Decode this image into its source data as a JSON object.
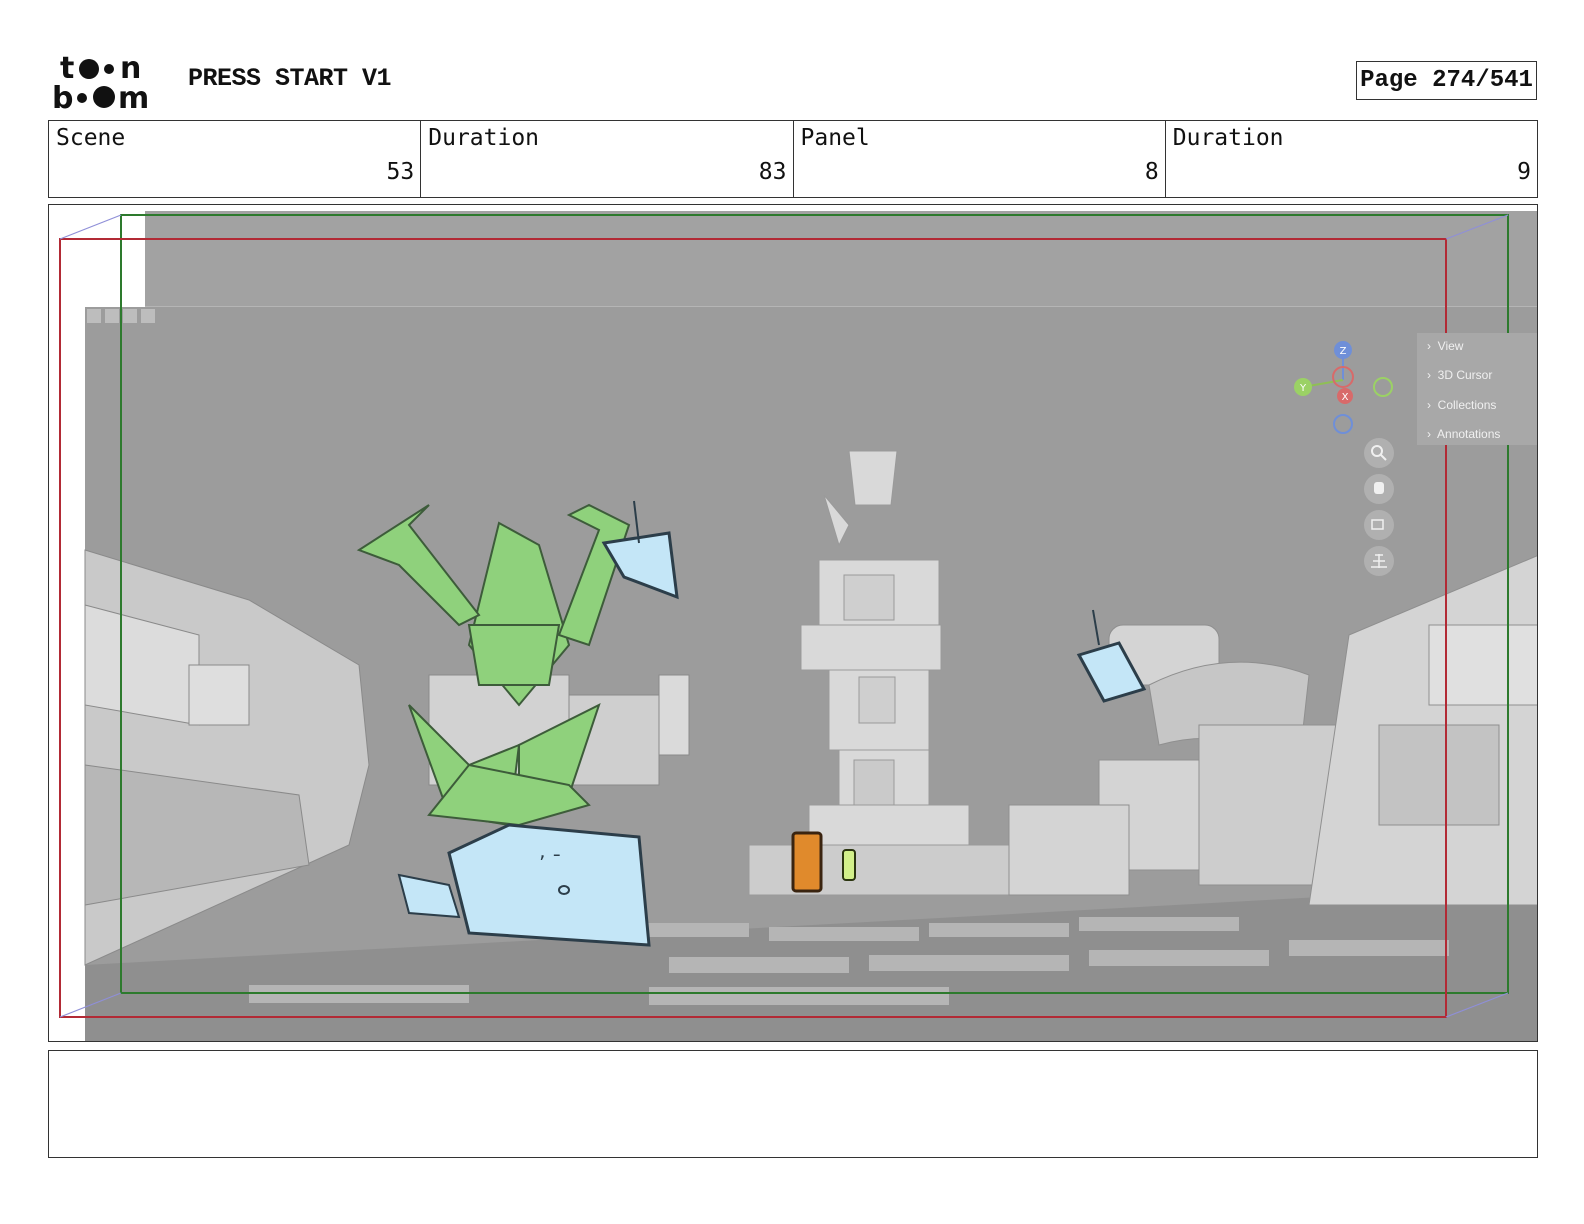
{
  "header": {
    "logo_alt": "toon boom",
    "project_title": "PRESS START V1",
    "page_label": "Page 274/541"
  },
  "info": {
    "scene_label": "Scene",
    "scene_value": "53",
    "scene_duration_label": "Duration",
    "scene_duration_value": "83",
    "panel_label": "Panel",
    "panel_value": "8",
    "panel_duration_label": "Duration",
    "panel_duration_value": "9"
  },
  "viewport_panel": {
    "items": [
      "View",
      "3D Cursor",
      "Collections",
      "Annotations"
    ],
    "gizmo": {
      "z_label": "Z",
      "y_label": "Y",
      "x_label": "X"
    },
    "tool_icons": [
      "zoom-icon",
      "hand-pan-icon",
      "camera-icon",
      "grid-icon"
    ]
  },
  "colors": {
    "safe_frame_red": "#b22a35",
    "camera_frame_green": "#2d7a2d",
    "sketch_green": "#8fd17c",
    "sketch_blue": "#c4e6f7",
    "viewport_gray": "#9c9c9c"
  },
  "notes": {
    "text": ""
  }
}
